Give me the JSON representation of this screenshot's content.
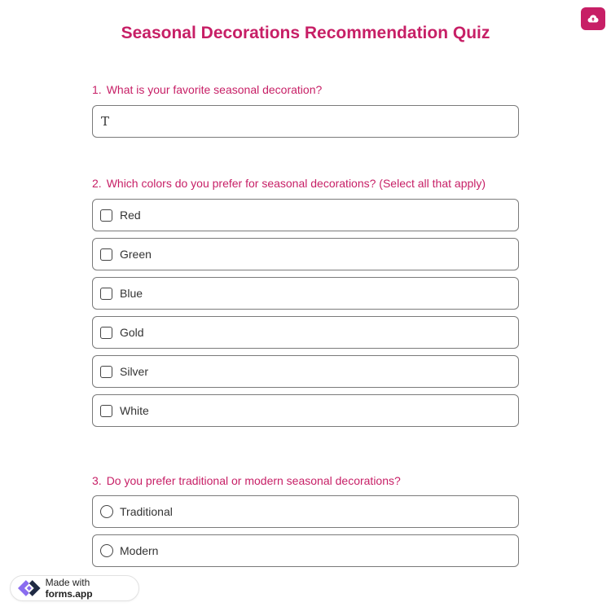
{
  "colors": {
    "accent": "#c71f66",
    "border": "#7a7a7a",
    "text": "#333333"
  },
  "header": {
    "title": "Seasonal Decorations Recommendation Quiz",
    "top_button_icon": "cloud-upload-icon"
  },
  "questions": [
    {
      "number": "1.",
      "text": "What is your favorite seasonal decoration?",
      "type": "text",
      "value": "",
      "input_icon": "text-t-icon"
    },
    {
      "number": "2.",
      "text": "Which colors do you prefer for seasonal decorations? (Select all that apply)",
      "type": "checkbox",
      "options": [
        {
          "label": "Red",
          "checked": false
        },
        {
          "label": "Green",
          "checked": false
        },
        {
          "label": "Blue",
          "checked": false
        },
        {
          "label": "Gold",
          "checked": false
        },
        {
          "label": "Silver",
          "checked": false
        },
        {
          "label": "White",
          "checked": false
        }
      ]
    },
    {
      "number": "3.",
      "text": "Do you prefer traditional or modern seasonal decorations?",
      "type": "radio",
      "options": [
        {
          "label": "Traditional",
          "checked": false
        },
        {
          "label": "Modern",
          "checked": false
        }
      ]
    }
  ],
  "footer": {
    "badge_prefix": "Made with",
    "badge_brand": "forms.app",
    "logo_icon": "forms-app-logo-icon"
  }
}
